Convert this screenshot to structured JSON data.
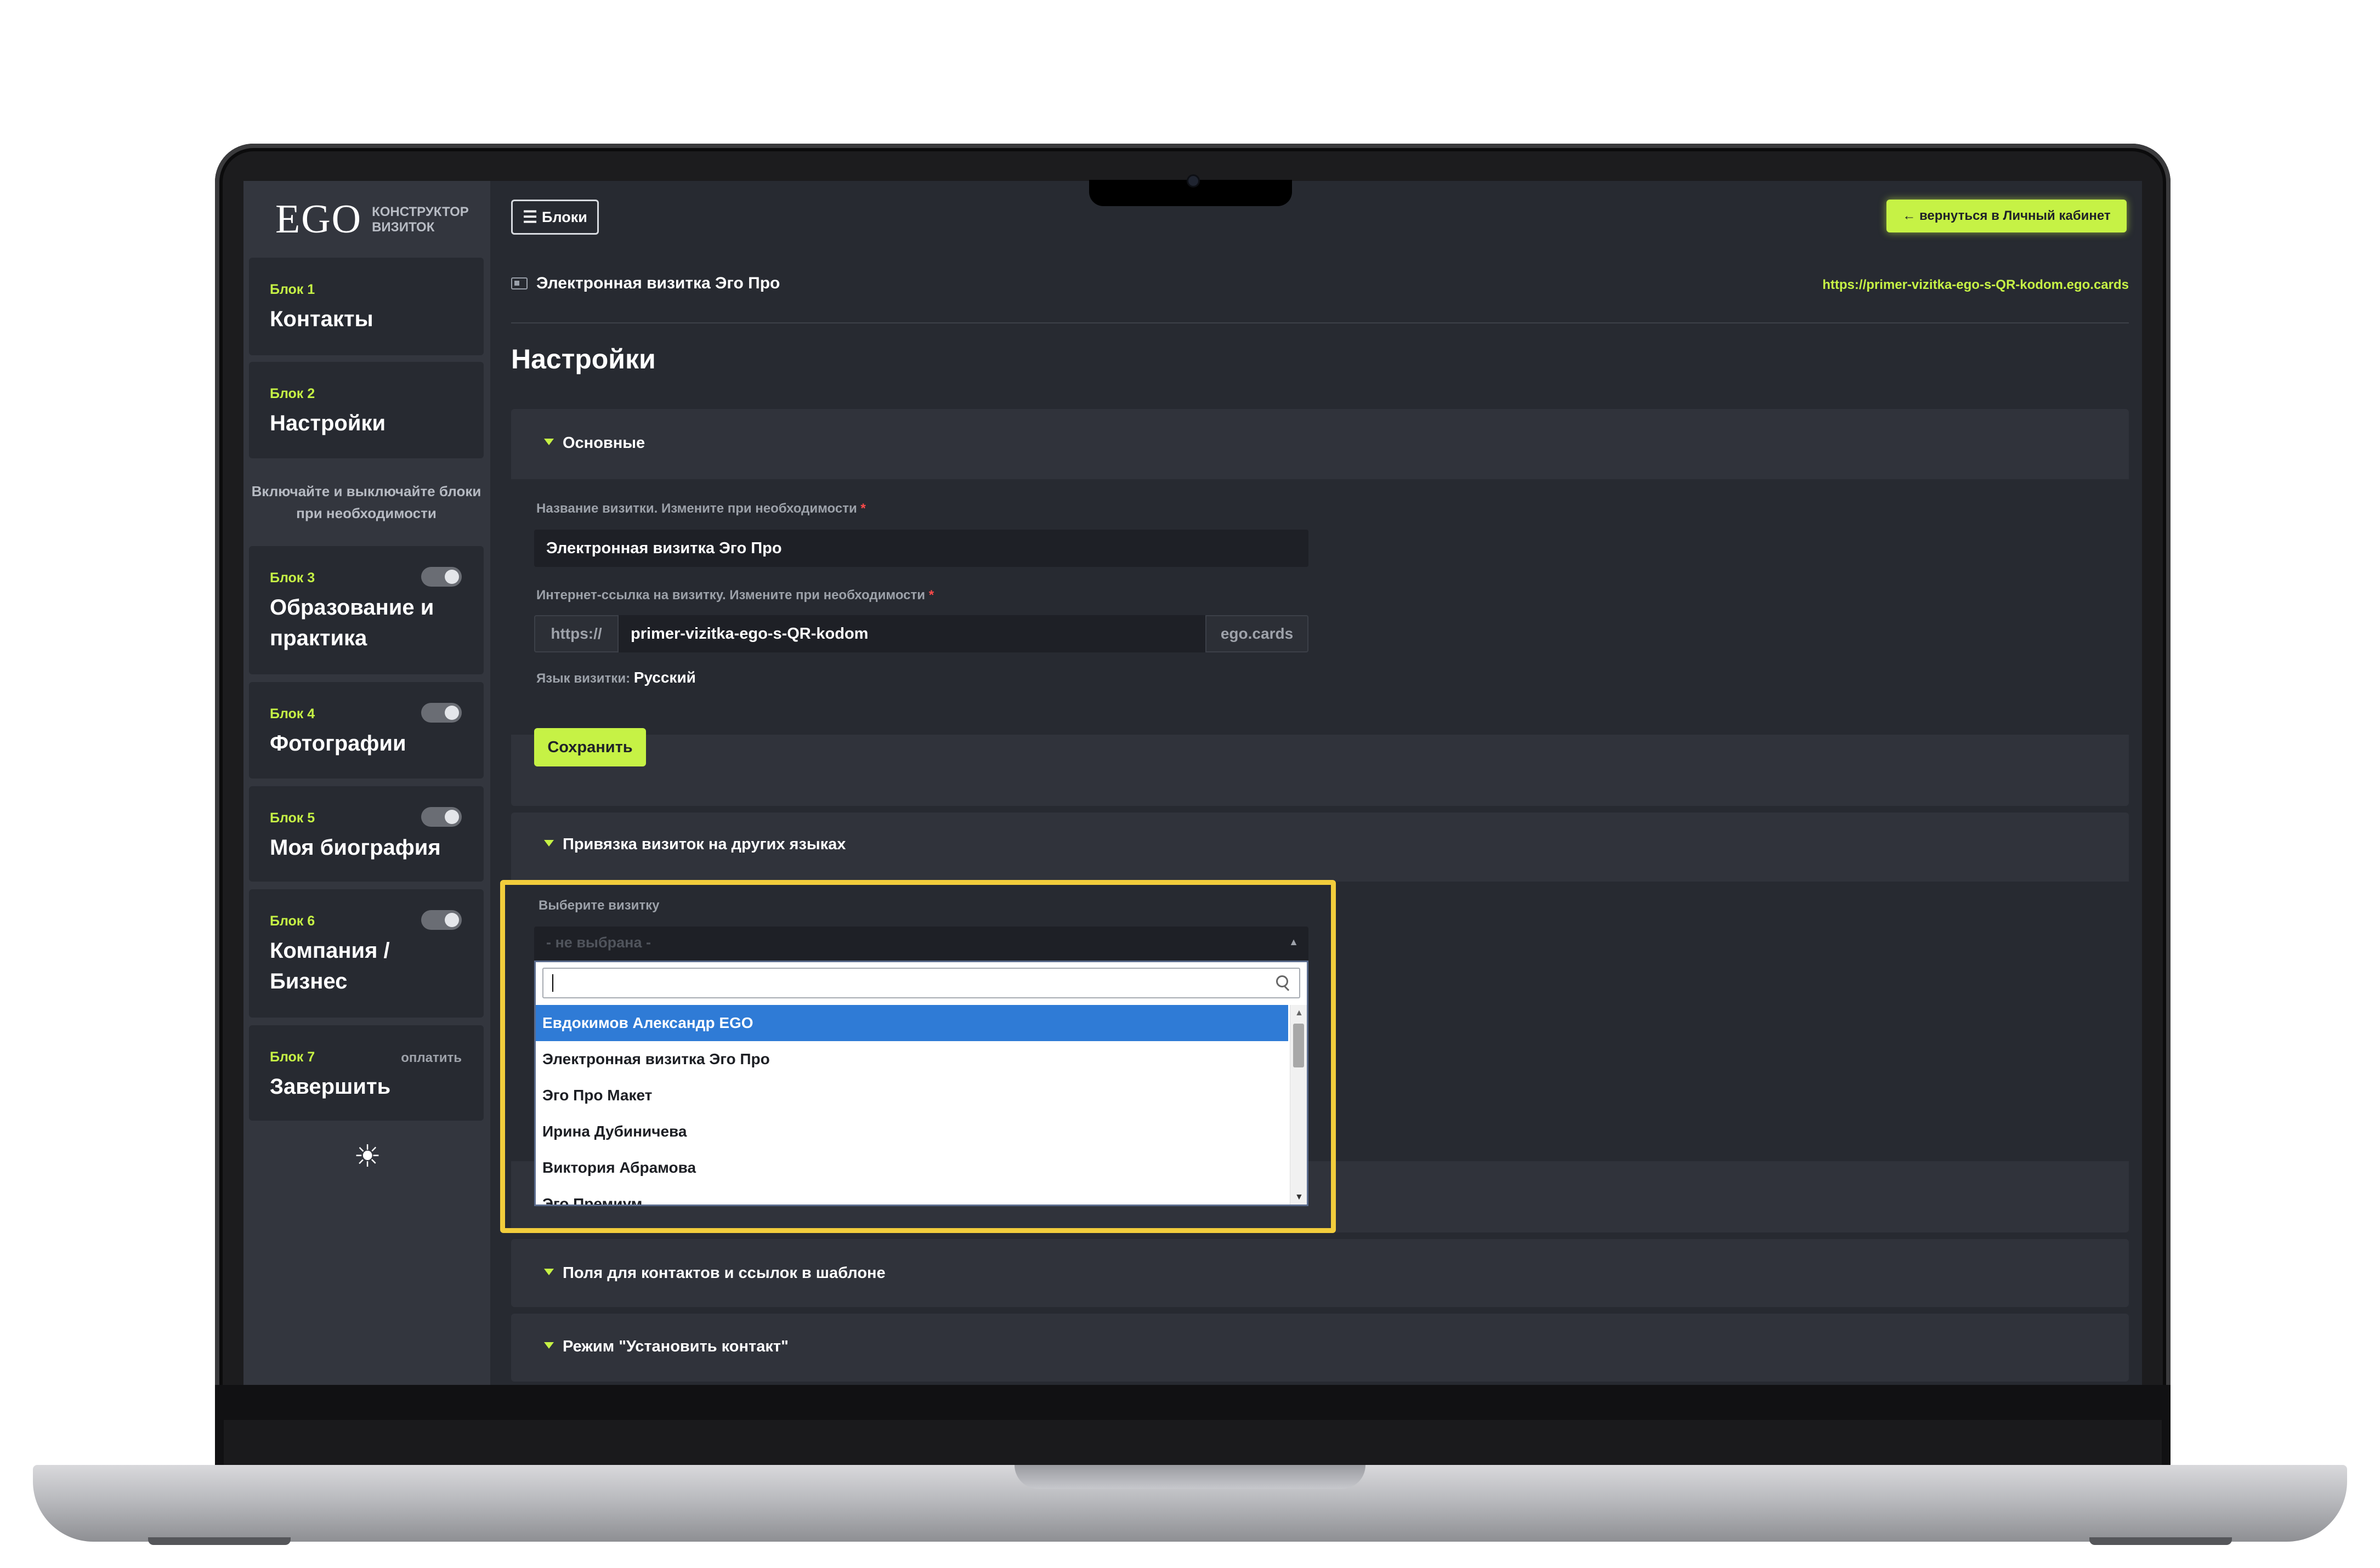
{
  "logo": {
    "brand": "EGO",
    "subtitle": "КОНСТРУКТОР ВИЗИТОК"
  },
  "sidebar": {
    "blocks": [
      {
        "num": "Блок 1",
        "title": "Контакты"
      },
      {
        "num": "Блок 2",
        "title": "Настройки"
      },
      {
        "num": "Блок 3",
        "title": "Образование и практика",
        "toggle": true
      },
      {
        "num": "Блок 4",
        "title": "Фотографии",
        "toggle": true
      },
      {
        "num": "Блок 5",
        "title": "Моя биография",
        "toggle": true
      },
      {
        "num": "Блок 6",
        "title": "Компания / Бизнес",
        "toggle": true
      },
      {
        "num": "Блок 7",
        "title": "Завершить",
        "badge": "оплатить"
      }
    ],
    "note": "Включайте и выключайте блоки при необходимости",
    "settings_icon": "gear-icon"
  },
  "header": {
    "blocks_button": "Блоки",
    "blocks_icon": "menu-icon",
    "back_button": "← вернуться в Личный кабинет"
  },
  "card": {
    "name": "Электронная визитка Эго Про",
    "url": "https://primer-vizitka-ego-s-QR-kodom.ego.cards",
    "icon": "id-card-icon"
  },
  "page_title": "Настройки",
  "basic": {
    "heading": "Основные",
    "name_label": "Название визитки. Измените при необходимости",
    "name_value": "Электронная визитка Эго Про",
    "link_label": "Интернет-ссылка на визитку. Измените при необходимости",
    "link_prefix": "https://",
    "link_value": "primer-vizitka-ego-s-QR-kodom",
    "link_suffix": "ego.cards",
    "lang_label": "Язык визитки:",
    "lang_value": "Русский",
    "save": "Сохранить",
    "required_mark": "*"
  },
  "lang_link": {
    "heading": "Привязка визиток на других языках",
    "select_label": "Выберите визитку",
    "placeholder": "- не выбрана -",
    "search_value": "",
    "options": [
      "Евдокимов Александр EGO",
      "Электронная визитка Эго Про",
      "Эго Про Макет",
      "Ирина Дубиничева",
      "Виктория Абрамова",
      "Эго Премиум"
    ],
    "active_option": "Евдокимов Александр EGO"
  },
  "sections": [
    {
      "heading": "Поля для контактов и ссылок в шаблоне"
    },
    {
      "heading": "Режим \"Установить контакт\""
    }
  ],
  "colors": {
    "accent": "#c6f245",
    "highlight": "#f2cd3c",
    "selected": "#2f7bd6",
    "background": "#272a31"
  }
}
